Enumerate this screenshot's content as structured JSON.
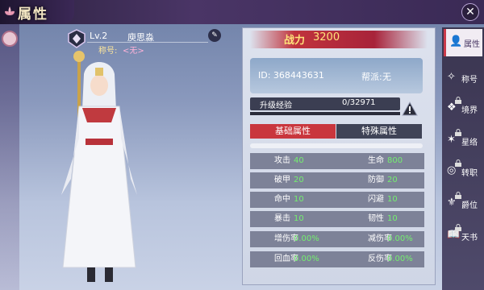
{
  "header": {
    "title": "属性"
  },
  "profile": {
    "level": "Lv.2",
    "name": "庾思淼",
    "title_label": "称号:",
    "title_value": "<无>"
  },
  "power": {
    "label": "战力",
    "value": "3200"
  },
  "info": {
    "id": "ID: 368443631",
    "guild_label": "帮派:",
    "guild_value": "无"
  },
  "exp": {
    "label": "升级经验",
    "value": "0/32971",
    "progress": 0
  },
  "tabs": {
    "basic": "基础属性",
    "special": "特殊属性",
    "active": "basic"
  },
  "stats": [
    {
      "left_name": "攻击",
      "left_value": "40",
      "right_name": "生命",
      "right_value": "800"
    },
    {
      "left_name": "破甲",
      "left_value": "20",
      "right_name": "防御",
      "right_value": "20"
    },
    {
      "left_name": "命中",
      "left_value": "10",
      "right_name": "闪避",
      "right_value": "10"
    },
    {
      "left_name": "暴击",
      "left_value": "10",
      "right_name": "韧性",
      "right_value": "10"
    },
    {
      "left_name": "增伤率",
      "left_value": "0.00%",
      "right_name": "减伤率",
      "right_value": "0.00%"
    },
    {
      "left_name": "回血率",
      "left_value": "0.00%",
      "right_name": "反伤率",
      "right_value": "0.00%"
    }
  ],
  "side_tabs": [
    {
      "label": "属性",
      "icon": "person-icon",
      "active": true,
      "locked": false
    },
    {
      "label": "称号",
      "icon": "title-icon",
      "active": false,
      "locked": false
    },
    {
      "label": "境界",
      "icon": "realm-icon",
      "active": false,
      "locked": true
    },
    {
      "label": "星络",
      "icon": "star-icon",
      "active": false,
      "locked": true
    },
    {
      "label": "转职",
      "icon": "transfer-icon",
      "active": false,
      "locked": true
    },
    {
      "label": "爵位",
      "icon": "rank-icon",
      "active": false,
      "locked": true
    },
    {
      "label": "天书",
      "icon": "book-icon",
      "active": false,
      "locked": true
    }
  ],
  "colors": {
    "accent_red": "#c9363d",
    "stat_value_green": "#74ef6f",
    "power_gold": "#ffe37a"
  }
}
